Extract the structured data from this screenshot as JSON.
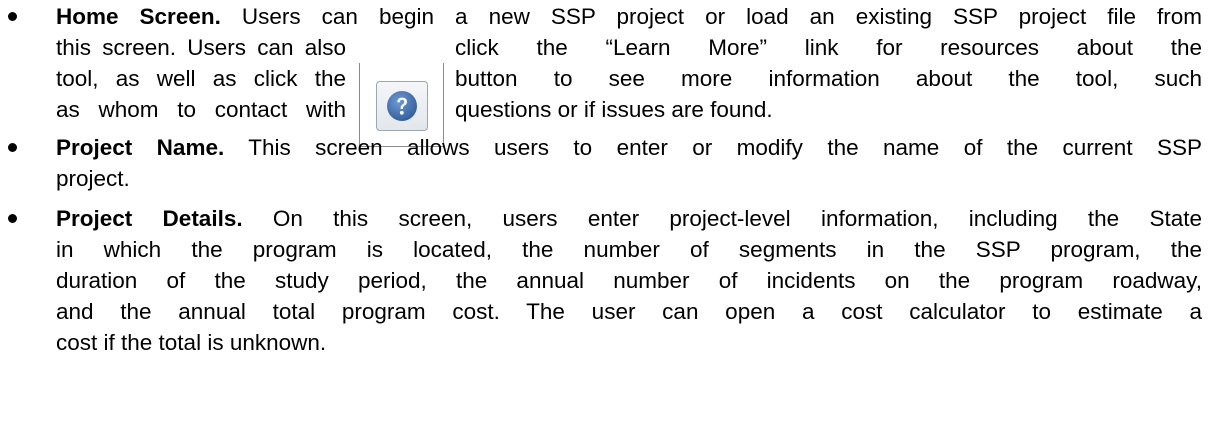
{
  "items": [
    {
      "heading": "Home Screen.",
      "lines": [
        "Users can begin a new SSP project or load an existing SSP project file from",
        "this screen. Users can also",
        "click the “Learn More” link for resources about the",
        "tool, as well as click the",
        "button to see more information about the tool, such",
        "as whom to contact with",
        "questions or if issues are found."
      ],
      "icon": "help-question-icon"
    },
    {
      "heading": "Project Name.",
      "lines": [
        "This screen allows users to enter or modify the name of the current SSP",
        "project."
      ]
    },
    {
      "heading": "Project Details.",
      "lines": [
        "On this screen, users enter project-level information, including the State",
        "in which the program is located, the number of segments in the SSP program, the",
        "duration of the study period, the annual number of incidents on the program roadway,",
        "and the annual total program cost. The user can open a cost calculator to estimate a",
        "cost if the total is unknown."
      ]
    }
  ],
  "colors": {
    "text": "#000000",
    "icon_circle": "#3b6aa8",
    "icon_glyph": "#ffffff"
  }
}
